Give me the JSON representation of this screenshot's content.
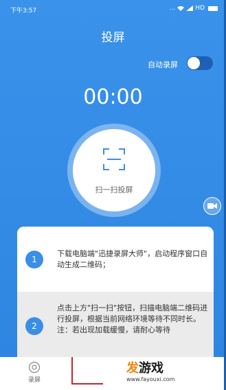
{
  "status_bar": {
    "time": "下午3:57",
    "dots": "...",
    "network": "HD"
  },
  "header": {
    "title": "投屏"
  },
  "auto_record": {
    "label": "自动录屏",
    "enabled": true
  },
  "timer": "00:00",
  "scan_button": {
    "label": "扫一扫投屏",
    "icon": "scan-frame-icon"
  },
  "record_button": {
    "icon": "video-camera-icon"
  },
  "steps": [
    {
      "number": "1",
      "text": "下载电脑端\"迅捷录屏大师\"，启动程序窗口自动生成二维码；"
    },
    {
      "number": "2",
      "text": "点击上方\"扫一扫\"按钮，扫描电脑端二维码进行投屏，根据当前网络环境等待不同时长。注：若出现加载缓慢，请耐心等待"
    }
  ],
  "bottom_nav": [
    {
      "label": "录屏",
      "icon": "record-icon"
    }
  ],
  "watermark": {
    "brand_first": "发",
    "brand_rest": "游戏",
    "url": "www.fayouxi.com"
  },
  "colors": {
    "primary": "#3a8ee8",
    "accent": "#f2860a"
  }
}
